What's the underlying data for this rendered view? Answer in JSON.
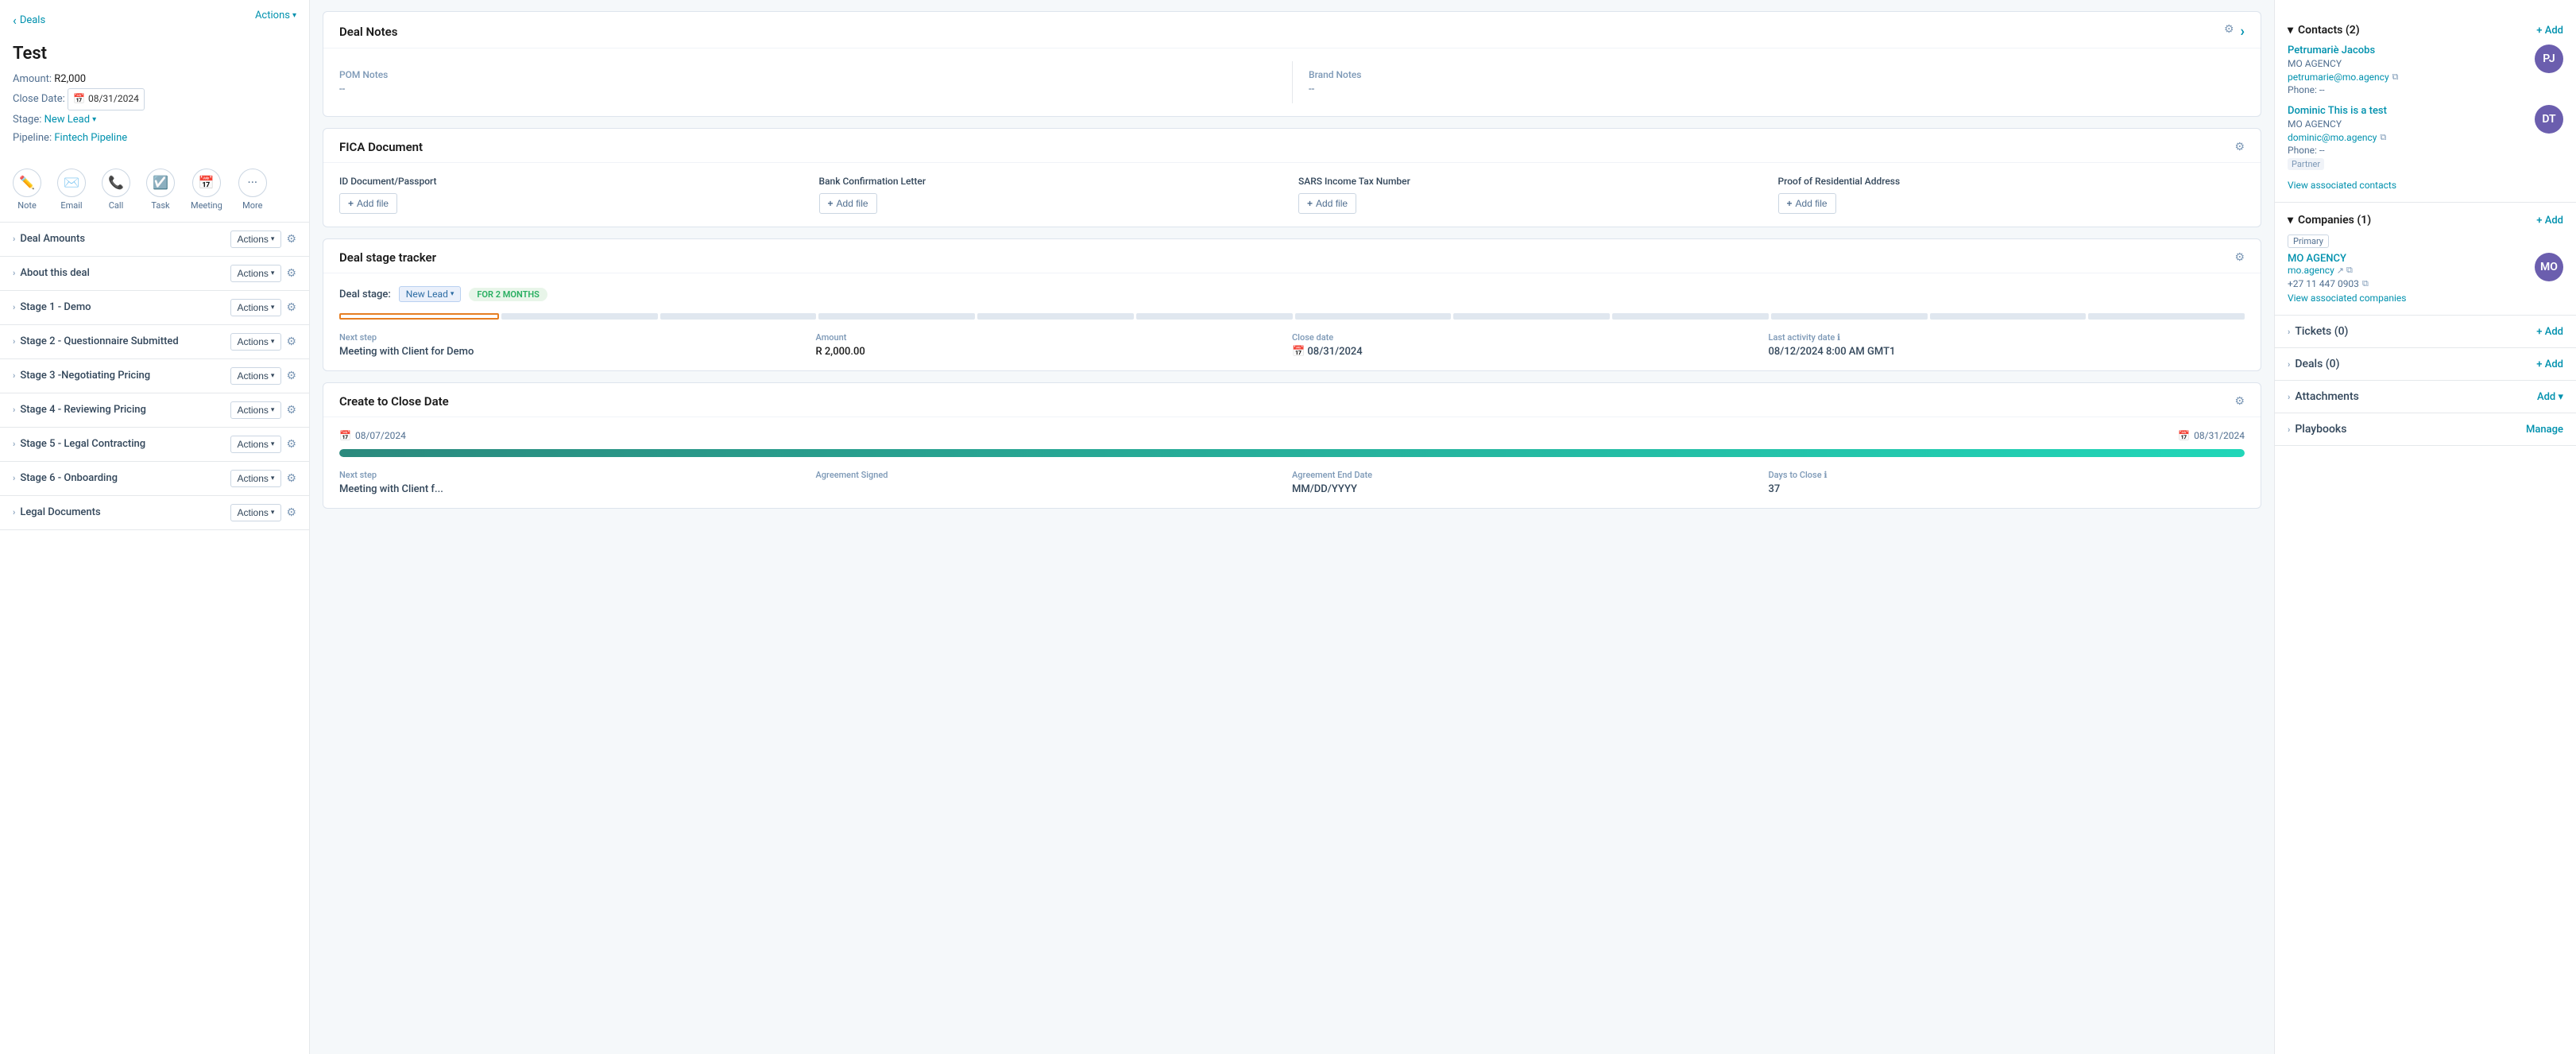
{
  "sidebar": {
    "back_label": "Deals",
    "actions_label": "Actions",
    "deal_title": "Test",
    "amount_label": "Amount:",
    "amount_value": "R2,000",
    "close_date_label": "Close Date:",
    "close_date_value": "08/31/2024",
    "stage_label": "Stage:",
    "stage_value": "New Lead",
    "pipeline_label": "Pipeline:",
    "pipeline_value": "Fintech Pipeline",
    "action_icons": [
      {
        "id": "note",
        "label": "Note",
        "icon": "✏️"
      },
      {
        "id": "email",
        "label": "Email",
        "icon": "✉️"
      },
      {
        "id": "call",
        "label": "Call",
        "icon": "📞"
      },
      {
        "id": "task",
        "label": "Task",
        "icon": "☑️"
      },
      {
        "id": "meeting",
        "label": "Meeting",
        "icon": "📅"
      },
      {
        "id": "more",
        "label": "More",
        "icon": "•••"
      }
    ],
    "sections": [
      {
        "id": "deal-amounts",
        "label": "Deal Amounts"
      },
      {
        "id": "about-deal",
        "label": "About this deal"
      },
      {
        "id": "stage1",
        "label": "Stage 1 - Demo"
      },
      {
        "id": "stage2",
        "label": "Stage 2 - Questionnaire Submitted"
      },
      {
        "id": "stage3",
        "label": "Stage 3 -Negotiating Pricing"
      },
      {
        "id": "stage4",
        "label": "Stage 4 - Reviewing Pricing"
      },
      {
        "id": "stage5",
        "label": "Stage 5 - Legal Contracting"
      },
      {
        "id": "stage6",
        "label": "Stage 6 - Onboarding"
      },
      {
        "id": "legal-docs",
        "label": "Legal Documents"
      }
    ]
  },
  "main": {
    "deal_notes": {
      "title": "Deal Notes",
      "pom_label": "POM Notes",
      "pom_value": "--",
      "brand_label": "Brand Notes",
      "brand_value": "--"
    },
    "fica": {
      "title": "FICA Document",
      "items": [
        {
          "label": "ID Document/Passport",
          "btn": "Add file"
        },
        {
          "label": "Bank Confirmation Letter",
          "btn": "Add file"
        },
        {
          "label": "SARS Income Tax Number",
          "btn": "Add file"
        },
        {
          "label": "Proof of Residential Address",
          "btn": "Add file"
        }
      ]
    },
    "stage_tracker": {
      "title": "Deal stage tracker",
      "stage_label": "Deal stage:",
      "stage_value": "New Lead",
      "duration": "FOR 2 MONTHS",
      "segments": 12,
      "active_segment": 0,
      "info": [
        {
          "label": "Next step",
          "value": "Meeting with Client for Demo"
        },
        {
          "label": "Amount",
          "value": "R 2,000.00"
        },
        {
          "label": "Close date",
          "value": "08/31/2024",
          "has_calendar": true
        },
        {
          "label": "Last activity date",
          "value": "08/12/2024 8:00 AM GMT1",
          "has_info": true
        }
      ]
    },
    "create_to_close": {
      "title": "Create to Close Date",
      "start_date": "08/07/2024",
      "end_date": "08/31/2024",
      "progress": 100,
      "info": [
        {
          "label": "Next step",
          "value": "Meeting with Client f..."
        },
        {
          "label": "Agreement Signed",
          "value": ""
        },
        {
          "label": "Agreement End Date",
          "value": "MM/DD/YYYY"
        },
        {
          "label": "Days to Close",
          "value": "37",
          "has_info": true
        }
      ]
    }
  },
  "right_panel": {
    "contacts": {
      "title": "Contacts",
      "count": 2,
      "add_label": "+ Add",
      "items": [
        {
          "name": "Petrumariè Jacobs",
          "company": "MO AGENCY",
          "email": "petrumarie@mo.agency",
          "phone": "Phone: --",
          "role": null,
          "avatar_initials": "PJ"
        },
        {
          "name": "Dominic This is a test",
          "company": "MO AGENCY",
          "email": "dominic@mo.agency",
          "phone": "Phone: --",
          "role": "Partner",
          "avatar_initials": "DT"
        }
      ],
      "view_link": "View associated contacts"
    },
    "companies": {
      "title": "Companies",
      "count": 1,
      "add_label": "+ Add",
      "primary_badge": "Primary",
      "name": "MO AGENCY",
      "website": "mo.agency",
      "phone": "+27 11 447 0903",
      "view_link": "View associated companies"
    },
    "tickets": {
      "title": "Tickets",
      "count": 0,
      "add_label": "+ Add"
    },
    "deals": {
      "title": "Deals",
      "count": 0,
      "add_label": "+ Add"
    },
    "attachments": {
      "title": "Attachments",
      "add_label": "Add ▾"
    },
    "playbooks": {
      "title": "Playbooks",
      "manage_label": "Manage"
    }
  }
}
